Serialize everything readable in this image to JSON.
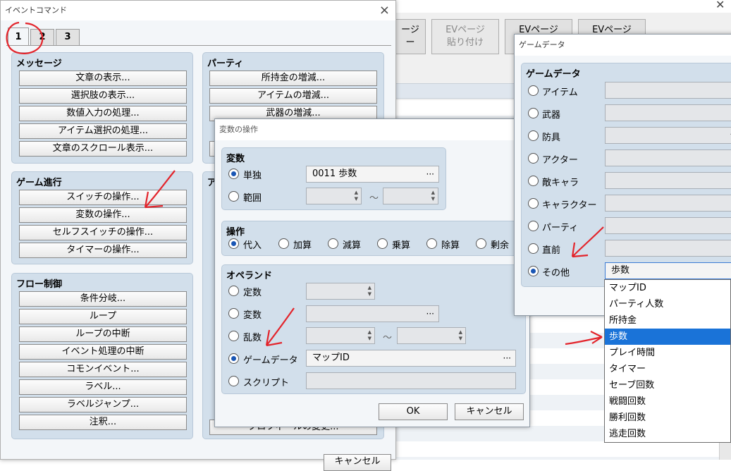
{
  "bg": {
    "buttons": [
      "ージ\nー",
      "EVページ\n貼り付け",
      "EVページ",
      "EVページ"
    ]
  },
  "event_window": {
    "title": "イベントコマンド",
    "tabs": [
      "1",
      "2",
      "3"
    ],
    "groups": {
      "message": {
        "title": "メッセージ",
        "items": [
          "文章の表示...",
          "選択肢の表示...",
          "数値入力の処理...",
          "アイテム選択の処理...",
          "文章のスクロール表示..."
        ]
      },
      "progress": {
        "title": "ゲーム進行",
        "items": [
          "スイッチの操作...",
          "変数の操作...",
          "セルフスイッチの操作...",
          "タイマーの操作..."
        ]
      },
      "flow": {
        "title": "フロー制御",
        "items": [
          "条件分岐...",
          "ループ",
          "ループの中断",
          "イベント処理の中断",
          "コモンイベント...",
          "ラベル...",
          "ラベルジャンプ...",
          "注釈..."
        ]
      },
      "party": {
        "title": "パーティ",
        "items": [
          "所持金の増減...",
          "アイテムの増減...",
          "武器の増減..."
        ]
      },
      "actor_partial": {
        "title": "ア"
      },
      "bottom_partial": "プロフィールの変更...",
      "bottom_button": "キャンセル"
    }
  },
  "variable_window": {
    "title": "変数の操作",
    "variable": {
      "title": "変数",
      "single_label": "単独",
      "single_value": "0011 歩数",
      "range_label": "範囲",
      "tilde": "～"
    },
    "operation": {
      "title": "操作",
      "options": [
        "代入",
        "加算",
        "減算",
        "乗算",
        "除算",
        "剰余"
      ]
    },
    "operand": {
      "title": "オペランド",
      "constant_label": "定数",
      "variable_label": "変数",
      "random_label": "乱数",
      "gamedata_label": "ゲームデータ",
      "gamedata_value": "マップID",
      "script_label": "スクリプト",
      "tilde": "～"
    },
    "ok": "OK",
    "cancel": "キャンセル"
  },
  "gamedata_window": {
    "title": "ゲームデータ",
    "group_title": "ゲームデータ",
    "options": [
      "アイテム",
      "武器",
      "防具",
      "アクター",
      "敵キャラ",
      "キャラクター",
      "パーティ",
      "直前",
      "その他"
    ],
    "selected_value": "歩数",
    "dropdown": [
      "マップID",
      "パーティ人数",
      "所持金",
      "歩数",
      "プレイ時間",
      "タイマー",
      "セーブ回数",
      "戦闘回数",
      "勝利回数",
      "逃走回数"
    ],
    "dropdown_selected_index": 3
  },
  "colors": {
    "annotation": "#e3242b",
    "selection": "#1a73d8",
    "group_bg": "#d2dfeb"
  }
}
